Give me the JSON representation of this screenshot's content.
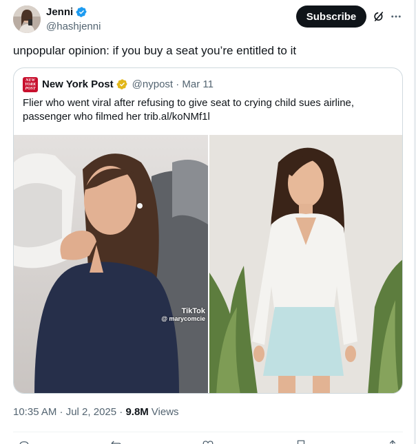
{
  "author": {
    "name": "Jenni",
    "handle": "@hashjenni",
    "verified_icon": "verified-badge-icon"
  },
  "header": {
    "subscribe_label": "Subscribe",
    "grok_icon": "grok-icon",
    "more_icon": "more-options-icon"
  },
  "tweet": {
    "text": "unpopular opinion: if you buy a seat you’re entitled to it"
  },
  "quote": {
    "logo_text": "NEW YORK POST",
    "name": "New York Post",
    "handle_date": "@nypost · Mar 11",
    "text": "Flier who went viral after refusing to give seat to crying child sues airline, passenger who filmed her trib.al/koNMf1l",
    "watermark_brand": "TikTok",
    "watermark_user": "@ marycomcie"
  },
  "meta": {
    "time_date": "10:35 AM · Jul 2, 2025 · ",
    "views_count": "9.8M",
    "views_label": "Views"
  },
  "colors": {
    "text_primary": "#0f1419",
    "text_secondary": "#536471",
    "border": "#cfd9de",
    "verified_blue": "#1d9bf0",
    "verified_gold": "#e2b719",
    "nypost_red": "#c8102e"
  }
}
